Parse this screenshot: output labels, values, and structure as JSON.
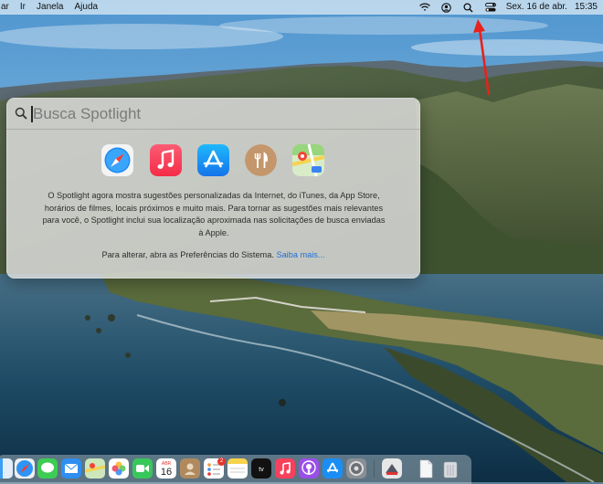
{
  "menubar": {
    "items": [
      "ar",
      "Ir",
      "Janela",
      "Ajuda"
    ],
    "date": "Sex. 16 de abr.",
    "time": "15:35",
    "status_icons": [
      "wifi-icon",
      "user-account-icon",
      "spotlight-search-icon",
      "control-center-icon"
    ]
  },
  "annotation": {
    "color": "#e8211c"
  },
  "spotlight": {
    "placeholder": "Busca Spotlight",
    "value": "",
    "apps": [
      "Safari",
      "Music",
      "App Store",
      "Restaurants",
      "Maps"
    ],
    "description": "O Spotlight agora mostra sugestões personalizadas da Internet, do iTunes, da App Store, horários de filmes, locais próximos e muito mais. Para tornar as sugestões mais relevantes para você, o Spotlight inclui sua localização aproximada nas solicitações de busca enviadas à Apple.",
    "footer_text": "Para alterar, abra as Preferências do Sistema.",
    "footer_link": "Saiba mais..."
  },
  "dock": {
    "apps": [
      "Finder",
      "Safari",
      "Messages",
      "Mail",
      "Maps",
      "Photos",
      "FaceTime",
      "Calendar",
      "Contacts",
      "Reminders",
      "Notes",
      "TV",
      "Music",
      "Podcasts",
      "App Store",
      "System Preferences",
      "Preview",
      "Document",
      "Trash"
    ],
    "calendar": {
      "month": "ABR",
      "day": "16"
    },
    "reminders_badge": "2"
  }
}
